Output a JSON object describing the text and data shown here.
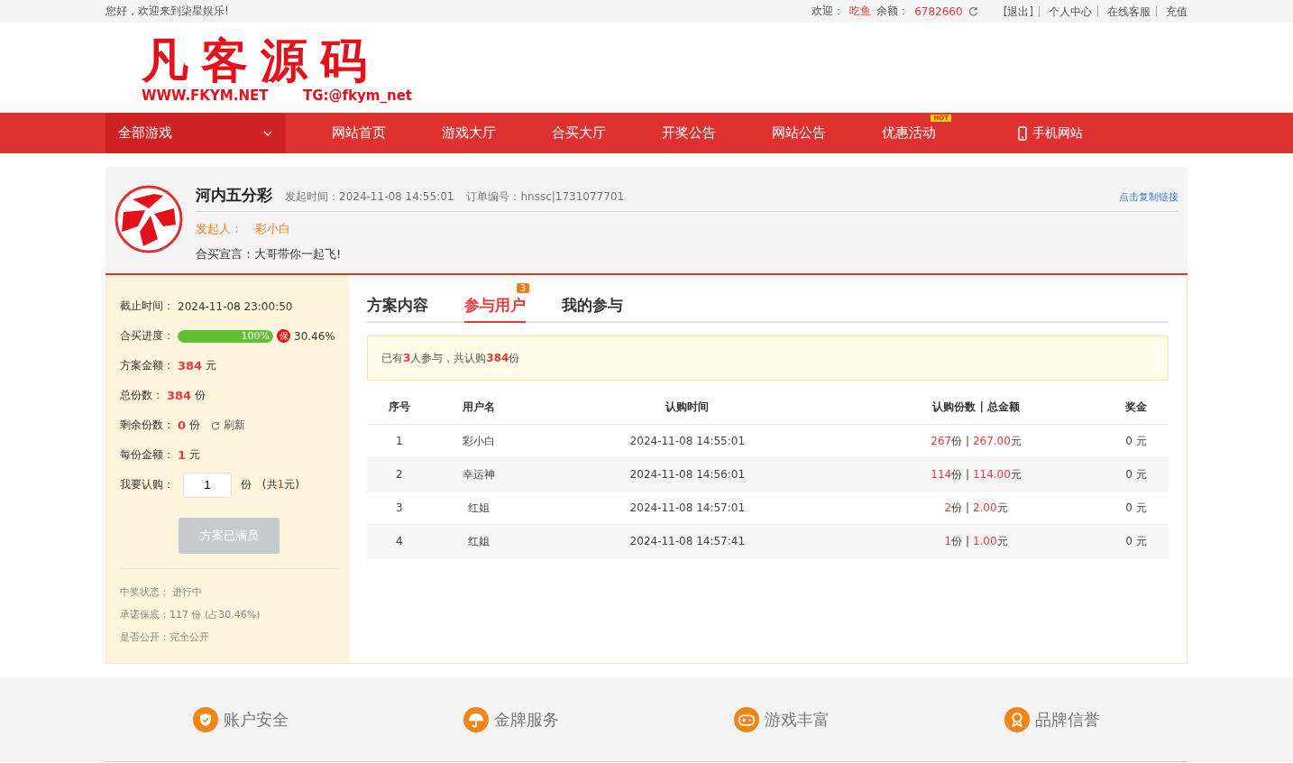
{
  "top_bar": {
    "greeting": "您好，欢迎来到柒星娱乐!",
    "user_label": "欢迎：",
    "user_name": "吃鱼",
    "balance_label": "余额：",
    "balance": "6782660",
    "links": [
      "[退出]",
      "个人中心",
      "在线客服",
      "充值"
    ]
  },
  "logo": {
    "title": "凡客源码",
    "site": "WWW.FKYM.NET",
    "contact": "TG:@fkym_net"
  },
  "nav": {
    "category": "全部游戏",
    "items": [
      {
        "label": "网站首页"
      },
      {
        "label": "游戏大厅"
      },
      {
        "label": "合买大厅"
      },
      {
        "label": "开奖公告"
      },
      {
        "label": "网站公告"
      },
      {
        "label": "优惠活动",
        "badge": "HOT"
      }
    ],
    "mobile": "手机网站"
  },
  "order": {
    "game": "河内五分彩",
    "start_time": "发起时间：2024-11-08 14:55:01",
    "order_no": "订单编号：hnssc|1731077701",
    "copy_link": "点击复制链接",
    "initiator_label": "发起人：",
    "initiator": "彩小白",
    "slogan": "合买宣言：大哥带你一起飞!"
  },
  "summary": {
    "deadline_label": "截止时间：",
    "deadline": "2024-11-08 23:00:50",
    "progress_label": "合买进度：",
    "level": 1,
    "progress_text": "100%",
    "guarantee_icon": "保",
    "guarantee_pct": "30.46%",
    "stats": [
      {
        "label": "方案金额：",
        "value": "384",
        "unit": "元"
      },
      {
        "label": "总份数：",
        "value": "384",
        "unit": "份"
      },
      {
        "label": "剩余份数：",
        "value": "0",
        "unit": "份",
        "action": "刷新"
      },
      {
        "label": "每份金额：",
        "value": "1",
        "unit": "元"
      }
    ],
    "buy_label": "我要认购：",
    "buy_value": "1",
    "buy_unit": "份",
    "buy_total": "(共**1**元)",
    "submit": "方案已满员",
    "submit_disabled": true,
    "notes": [
      "中奖状态： 进行中",
      "承诺保底：117 份 (占30.46%)",
      "是否公开：完全公开"
    ]
  },
  "tabs": [
    {
      "label": "方案内容",
      "selected": false
    },
    {
      "label": "参与用户",
      "selected": true,
      "badge": "3"
    },
    {
      "label": "我的参与",
      "selected": false
    }
  ],
  "notice": "已有**3**人参与，共认购**384**份",
  "table": {
    "columns": [
      "序号",
      "用户名",
      "认购时间",
      "认购份数 | 总金额",
      "奖金"
    ],
    "rows": [
      {
        "no": "1",
        "user": "彩小白",
        "time": "2024-11-08 14:55:01",
        "shares": "**267**份 | **267.00**元",
        "prize": "0 元"
      },
      {
        "no": "2",
        "user": "幸运神",
        "time": "2024-11-08 14:56:01",
        "shares": "**114**份 | **114.00**元",
        "prize": "0 元"
      },
      {
        "no": "3",
        "user": "红姐",
        "time": "2024-11-08 14:57:01",
        "shares": "**2**份 | **2.00**元",
        "prize": "0 元"
      },
      {
        "no": "4",
        "user": "红姐",
        "time": "2024-11-08 14:57:41",
        "shares": "**1**份 | **1.00**元",
        "prize": "0 元"
      }
    ]
  },
  "footer": [
    {
      "kind": "shield",
      "label": "账户安全"
    },
    {
      "kind": "umbrella",
      "label": "金牌服务"
    },
    {
      "kind": "gamepad",
      "label": "游戏丰富"
    },
    {
      "kind": "medal",
      "label": "品牌信誉"
    }
  ]
}
